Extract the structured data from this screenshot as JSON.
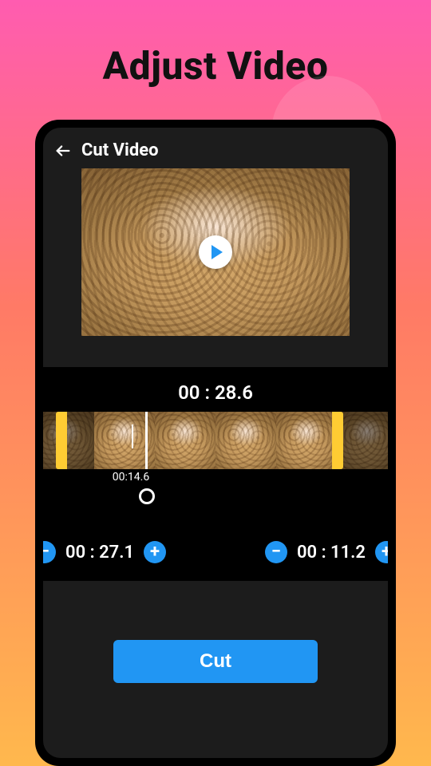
{
  "hero_title": "Adjust Video",
  "topbar": {
    "title": "Cut Video"
  },
  "total_time": "00 : 28.6",
  "playhead_time": "00:14.6",
  "start_time": "00 : 27.1",
  "end_time": "00 : 11.2",
  "cut_label": "Cut",
  "icons": {
    "back": "back-arrow-icon",
    "play": "play-icon",
    "minus": "minus-icon",
    "plus": "plus-icon"
  },
  "colors": {
    "accent": "#2196f3",
    "selection": "#ffcc33"
  }
}
